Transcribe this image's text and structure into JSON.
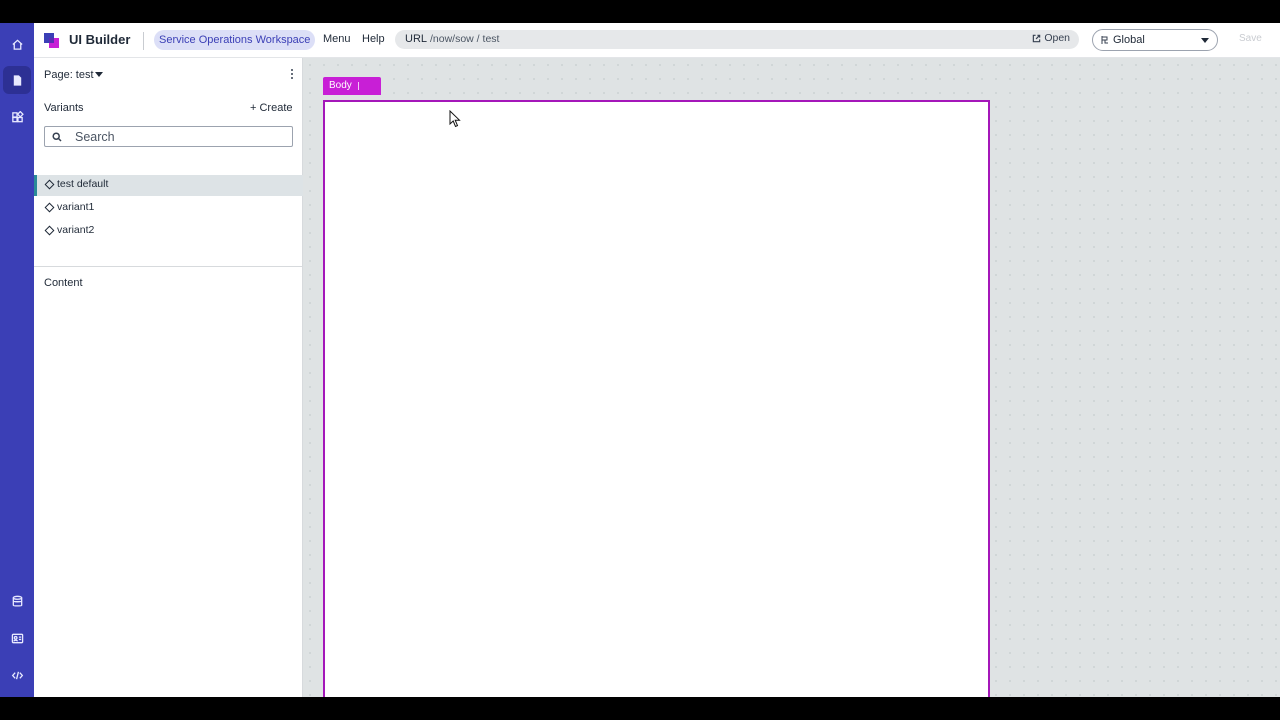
{
  "header": {
    "app_title": "UI Builder",
    "workspace": "Service Operations Workspace",
    "menu_label": "Menu",
    "help_label": "Help",
    "url_label": "URL",
    "url_path": "/now/sow / test",
    "open_label": "Open",
    "scope_value": "Global",
    "save_label": "Save"
  },
  "rail": {
    "icons": [
      "home-icon",
      "page-icon",
      "components-icon",
      "data-icon",
      "form-icon",
      "code-icon"
    ],
    "accent_color": "#3b3fb6"
  },
  "panel": {
    "page_label": "Page: test",
    "variants_title": "Variants",
    "create_label": "+ Create",
    "search_placeholder": "Search",
    "variants": [
      {
        "label": "test default",
        "selected": true
      },
      {
        "label": "variant1",
        "selected": false
      },
      {
        "label": "variant2",
        "selected": false
      }
    ],
    "content_title": "Content"
  },
  "canvas": {
    "selected_component": "Body",
    "selection_color": "#c81fd6"
  }
}
